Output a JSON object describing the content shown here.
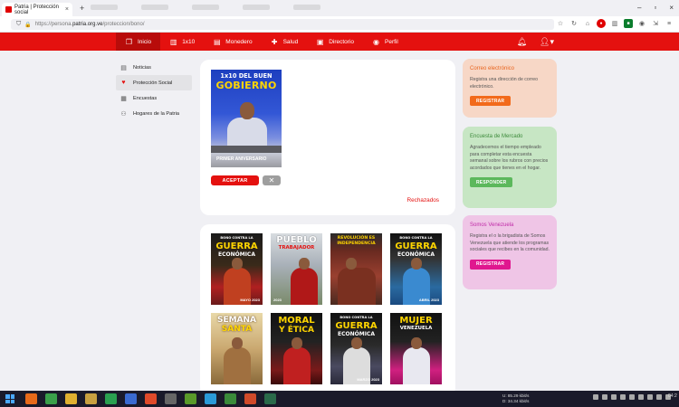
{
  "browser": {
    "tab_title": "Patria | Protección social",
    "url_prefix": "https://persona.",
    "url_host": "patria.org.ve",
    "url_path": "/proteccion/bono/"
  },
  "appbar": {
    "menu": [
      {
        "label": "Inicio",
        "icon": "book-icon",
        "active": true
      },
      {
        "label": "1x10",
        "icon": "chart-icon"
      },
      {
        "label": "Monedero",
        "icon": "wallet-icon"
      },
      {
        "label": "Salud",
        "icon": "health-icon"
      },
      {
        "label": "Directorio",
        "icon": "directory-icon"
      },
      {
        "label": "Perfil",
        "icon": "profile-icon"
      }
    ]
  },
  "sidebar": {
    "items": [
      {
        "label": "Noticias",
        "icon": "news-icon"
      },
      {
        "label": "Protección Social",
        "icon": "social-protection-icon",
        "active": true
      },
      {
        "label": "Encuestas",
        "icon": "survey-icon"
      },
      {
        "label": "Hogares de la Patria",
        "icon": "homes-icon"
      }
    ]
  },
  "bono": {
    "poster": {
      "title_top": "1x10 DEL BUEN",
      "title_main": "GOBIERNO",
      "footer": "PRIMER ANIVERSARIO"
    },
    "accept_label": "ACEPTAR",
    "close_symbol": "✕",
    "rejected_link": "Rechazados"
  },
  "gallery": {
    "posters": [
      {
        "top": "BONO CONTRA LA",
        "main": "GUERRA",
        "sub": "ECONÓMICA",
        "foot": "MAYO 2023"
      },
      {
        "top": "",
        "main": "PUEBLO",
        "sub": "TRABAJADOR",
        "foot": "2023"
      },
      {
        "top": "REVOLUCIÓN ES",
        "main": "INDEPENDENCIA",
        "sub": "",
        "foot": ""
      },
      {
        "top": "BONO CONTRA LA",
        "main": "GUERRA",
        "sub": "ECONÓMICA",
        "foot": "ABRIL 2023"
      },
      {
        "top": "",
        "main": "SEMANA",
        "sub": "SANTA",
        "foot": ""
      },
      {
        "top": "",
        "main": "MORAL",
        "sub": "Y ÉTICA",
        "foot": ""
      },
      {
        "top": "BONO CONTRA LA",
        "main": "GUERRA",
        "sub": "ECONÓMICA",
        "foot": "MARZO 2023"
      },
      {
        "top": "",
        "main": "MUJER",
        "sub": "VENEZUELA",
        "foot": ""
      }
    ]
  },
  "panels": [
    {
      "title": "Correo electrónico",
      "text": "Registra una dirección de correo electrónico.",
      "button": "REGISTRAR"
    },
    {
      "title": "Encuesta de Mercado",
      "text": "Agradecemos el tiempo empleado para completar esta encuesta semanal sobre los rubros con precios acordados que tienes en el hogar.",
      "button": "RESPONDER"
    },
    {
      "title": "Somos Venezuela",
      "text": "Registra el o la brigadista de Somos Venezuela que atiende los programas sociales que recibes en la comunidad.",
      "button": "REGISTRAR"
    }
  ],
  "taskbar": {
    "net_up_label": "U:",
    "net_up": "85.29 kbit/s",
    "net_down_label": "D:",
    "net_down": "34.34 kbit/s",
    "clock": "04:2"
  }
}
